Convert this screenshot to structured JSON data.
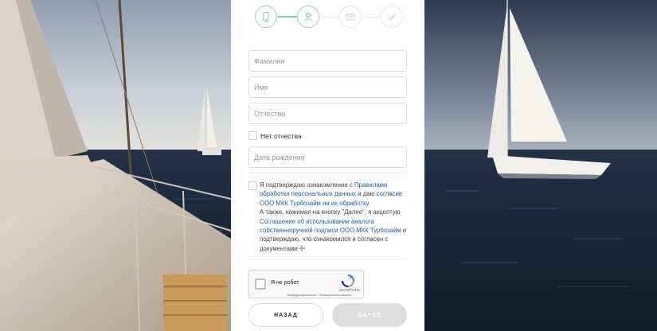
{
  "stepper": {
    "steps": [
      {
        "icon": "phone-icon",
        "state": "done"
      },
      {
        "icon": "user-icon",
        "state": "active"
      },
      {
        "icon": "mail-icon",
        "state": "pending"
      },
      {
        "icon": "check-icon",
        "state": "pending"
      }
    ],
    "accent_color": "#7fcdae"
  },
  "form": {
    "last_name_placeholder": "Фамилия",
    "first_name_placeholder": "Имя",
    "patronymic_placeholder": "Отчество",
    "no_patronymic_label": "Нет отчества",
    "birth_date_placeholder": "Дата рождения"
  },
  "consent": {
    "text_1": "Я подтверждаю ознакомление с ",
    "link_rules": "Правилами обработки персональных данных",
    "text_2": " и даю ",
    "link_agreement": "согласие ООО МКК Турбозайм на их обработку",
    "text_3": ".",
    "text_4": "А также, нажимая на кнопку \"Далее\", я акцептую ",
    "link_signature": "Соглашение об использовании аналога собственноручной подписи ООО МКК Турбозайм",
    "text_5": " и подтверждаю, что ознакомился и согласен с документами",
    "link_color": "#1d5fa8"
  },
  "recaptcha": {
    "label": "Я не робот",
    "brand": "reCAPTCHA",
    "links": "Конфиденциальность - Условия использования"
  },
  "buttons": {
    "back_label": "НАЗАД",
    "next_label": "ДАЛЕЕ"
  }
}
